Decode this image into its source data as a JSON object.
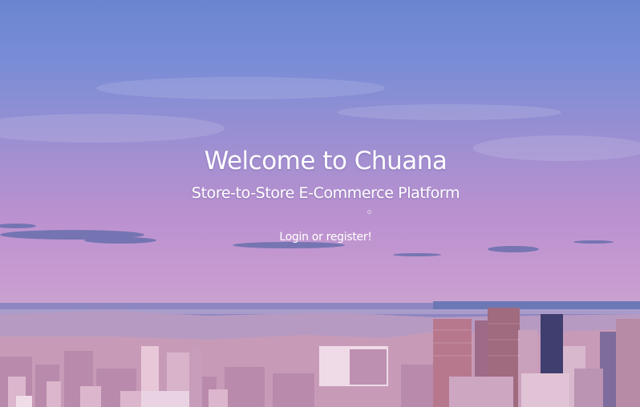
{
  "hero": {
    "title": "Welcome to Chuana",
    "subtitle": "Store-to-Store E-Commerce Platform",
    "cta_label": "Login or register!"
  },
  "colors": {
    "sky_top": "#6a86cf",
    "sky_bottom": "#c9a3cf",
    "text": "#ffffff"
  }
}
